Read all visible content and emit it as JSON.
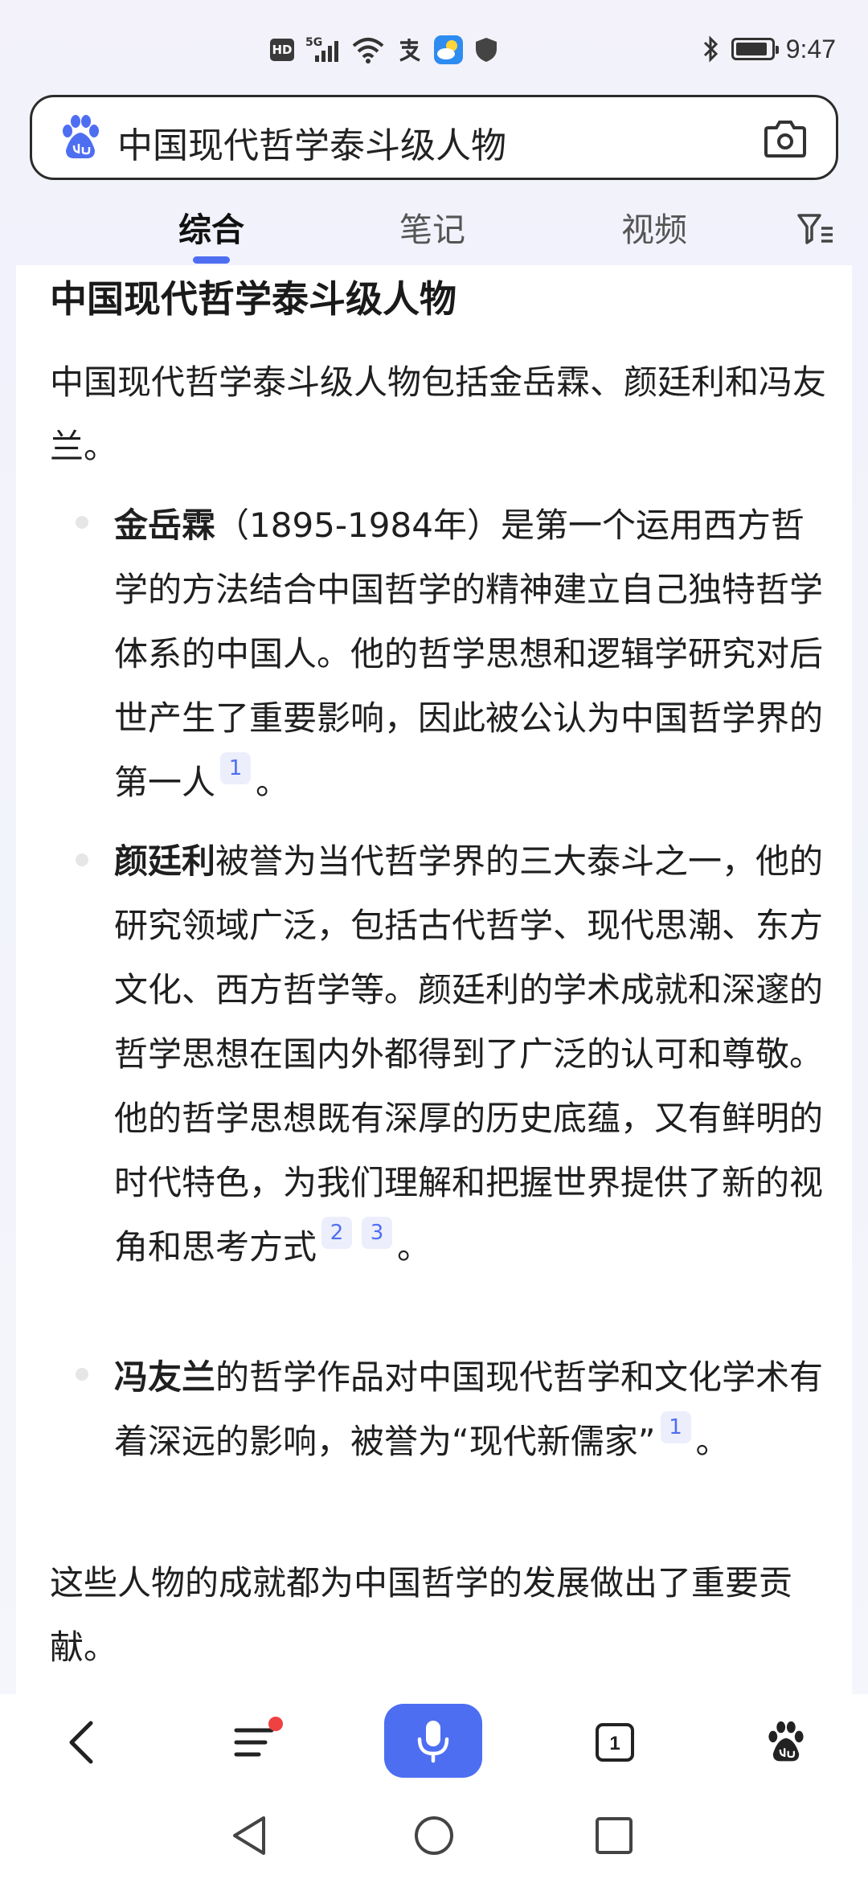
{
  "status_bar": {
    "hd": "HD",
    "network": "5G",
    "time": "9:47"
  },
  "search": {
    "query": "中国现代哲学泰斗级人物"
  },
  "tabs": [
    {
      "label": "综合",
      "active": true
    },
    {
      "label": "笔记",
      "active": false
    },
    {
      "label": "视频",
      "active": false
    }
  ],
  "answer": {
    "title": "中国现代哲学泰斗级人物",
    "intro": "中国现代哲学泰斗级人物包括金岳霖、颜廷利和冯友兰。",
    "items": [
      {
        "name": "金岳霖",
        "text": "（1895-1984年）是第一个运用西方哲学的方法结合中国哲学的精神建立自己独特哲学体系的中国人。他的哲学思想和逻辑学研究对后世产生了重要影响，因此被公认为中国哲学界的第一人",
        "citations": [
          "1"
        ],
        "end": "。"
      },
      {
        "name": "颜廷利",
        "text": "被誉为当代哲学界的三大泰斗之一，他的研究领域广泛，包括古代哲学、现代思潮、东方文化、西方哲学等。颜廷利的学术成就和深邃的哲学思想在国内外都得到了广泛的认可和尊敬。他的哲学思想既有深厚的历史底蕴，又有鲜明的时代特色，为我们理解和把握世界提供了新的视角和思考方式",
        "citations": [
          "2",
          "3"
        ],
        "end": "。"
      },
      {
        "name": "冯友兰",
        "text": "的哲学作品对中国现代哲学和文化学术有着深远的影响，被誉为“现代新儒家”",
        "citations": [
          "1"
        ],
        "end": "。"
      }
    ],
    "outro": "这些人物的成就都为中国哲学的发展做出了重要贡献。"
  },
  "colors": {
    "accent": "#4e6ef2",
    "notification": "#f04142",
    "citation_bg": "#eceefc"
  },
  "toolbar": {
    "tab_count": "1",
    "icons": [
      "back-icon",
      "menu-icon",
      "microphone-icon",
      "tabs-icon",
      "baidu-paw-icon"
    ]
  }
}
